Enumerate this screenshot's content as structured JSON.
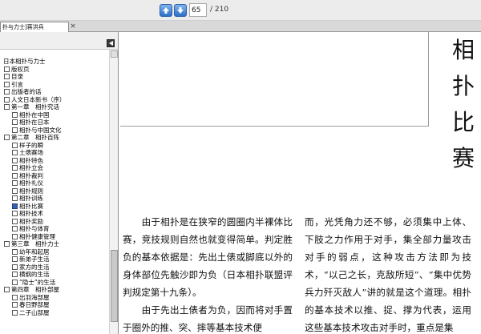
{
  "toolbar": {
    "up_icon": "arrow-up-icon",
    "down_icon": "arrow-down-icon",
    "page_value": "65",
    "page_total": "/ 210"
  },
  "tab": {
    "label": "扑与力士]蒋洪兵",
    "close_glyph": "×"
  },
  "tree": [
    {
      "label": "日本相扑与力士",
      "level": 0
    },
    {
      "label": "版权页",
      "level": 1
    },
    {
      "label": "目录",
      "level": 1
    },
    {
      "label": "引言",
      "level": 1
    },
    {
      "label": "出版者的话",
      "level": 1
    },
    {
      "label": "人文日本新书（序）",
      "level": 1
    },
    {
      "label": "第一章　相扑究话",
      "level": 1
    },
    {
      "label": "相扑在中国",
      "level": 2
    },
    {
      "label": "相扑在日本",
      "level": 2
    },
    {
      "label": "相扑与中国文化",
      "level": 2
    },
    {
      "label": "第二章　相扑百阵",
      "level": 1
    },
    {
      "label": "样子的瞬",
      "level": 2
    },
    {
      "label": "土俵赛场",
      "level": 2
    },
    {
      "label": "相扑特色",
      "level": 2
    },
    {
      "label": "相扑立会",
      "level": 2
    },
    {
      "label": "相扑裁判",
      "level": 2
    },
    {
      "label": "相扑礼仪",
      "level": 2
    },
    {
      "label": "相扑规则",
      "level": 2
    },
    {
      "label": "相扑训练",
      "level": 2
    },
    {
      "label": "相扑比赛",
      "level": 2,
      "selected": true
    },
    {
      "label": "相扑技术",
      "level": 2
    },
    {
      "label": "相扑奖励",
      "level": 2
    },
    {
      "label": "相扑与体育",
      "level": 2
    },
    {
      "label": "相扑健康管理",
      "level": 2
    },
    {
      "label": "第三章　相扑力士",
      "level": 1
    },
    {
      "label": "幼年和起居",
      "level": 2
    },
    {
      "label": "新弟子生活",
      "level": 2
    },
    {
      "label": "家方的生活",
      "level": 2
    },
    {
      "label": "横纲的生活",
      "level": 2
    },
    {
      "label": "“隐士”的生活",
      "level": 2
    },
    {
      "label": "第四章　相扑部屋",
      "level": 1
    },
    {
      "label": "出羽海部屋",
      "level": 2
    },
    {
      "label": "春日野部屋",
      "level": 2
    },
    {
      "label": "二子山部屋",
      "level": 2
    }
  ],
  "document": {
    "vertical_title": [
      "相",
      "扑",
      "比",
      "赛"
    ],
    "col1": [
      "　　由于相扑是在狭窄的圆圈内半裸体比赛，竞技规则自然也就变得简单。判定胜负的基本依据是：先出土俵或脚底以外的身体部位先触沙即为负（日本相扑联盟评判规定第十九条）。",
      "　　由于先出土俵者为负，因而将对手置于圈外的推、突、摔等基本技术便"
    ],
    "col2": [
      "而，光凭角力还不够，必须集中上体、下肢之力作用于对手，集全部力量攻击对手的弱点，这种攻击方法即为技术，“以己之长，克敌所短”、“集中优势兵力歼灭敌人”讲的就是这个道理。相扑的基本技术以推、捉、撑为代表，运用这些基本技术攻击对手时，重点是集"
    ]
  }
}
